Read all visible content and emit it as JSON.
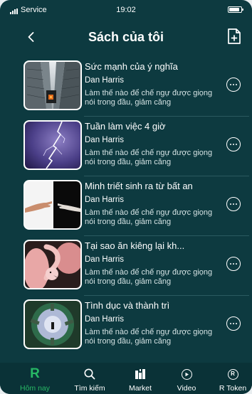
{
  "status_bar": {
    "carrier": "Service",
    "time": "19:02"
  },
  "header": {
    "title": "Sách của tôi",
    "back_icon": "chevron-left-icon",
    "add_icon": "file-add-icon"
  },
  "books": [
    {
      "title": "Sức mạnh của ý nghĩa",
      "author": "Dan Harris",
      "description": "Làm thế nào để chế ngự được giọng nói trong đầu, giảm căng",
      "cover": "skyscraper-cover"
    },
    {
      "title": "Tuần làm việc 4 giờ",
      "author": "Dan Harris",
      "description": "Làm thế nào để chế ngự được giọng nói trong đầu, giảm căng",
      "cover": "lightning-cover"
    },
    {
      "title": "Minh triết sinh ra từ bất an",
      "author": "Dan Harris",
      "description": "Làm thế nào để chế ngự được giọng nói trong đầu, giảm căng",
      "cover": "hands-cover"
    },
    {
      "title": "Tại sao ăn kiêng lại kh...",
      "author": "Dan Harris",
      "description": "Làm thế nào để chế ngự được giọng nói trong đầu, giảm căng",
      "cover": "flamingo-cover"
    },
    {
      "title": "Tình dục và thành trì",
      "author": "Dan Harris",
      "description": "Làm thế nào để chế ngự được giọng nói trong đầu, giảm căng",
      "cover": "fisheye-city-cover"
    }
  ],
  "nav": {
    "items": [
      {
        "label": "Hôm nay",
        "icon": "R",
        "active": true
      },
      {
        "label": "Tìm kiếm",
        "icon": "search-icon"
      },
      {
        "label": "Market",
        "icon": "market-icon"
      },
      {
        "label": "Video",
        "icon": "play-icon"
      },
      {
        "label": "R Token",
        "icon": "R"
      }
    ]
  },
  "colors": {
    "background": "#0d3a40",
    "accent": "#27b865",
    "nav_background": "#0a3237"
  }
}
